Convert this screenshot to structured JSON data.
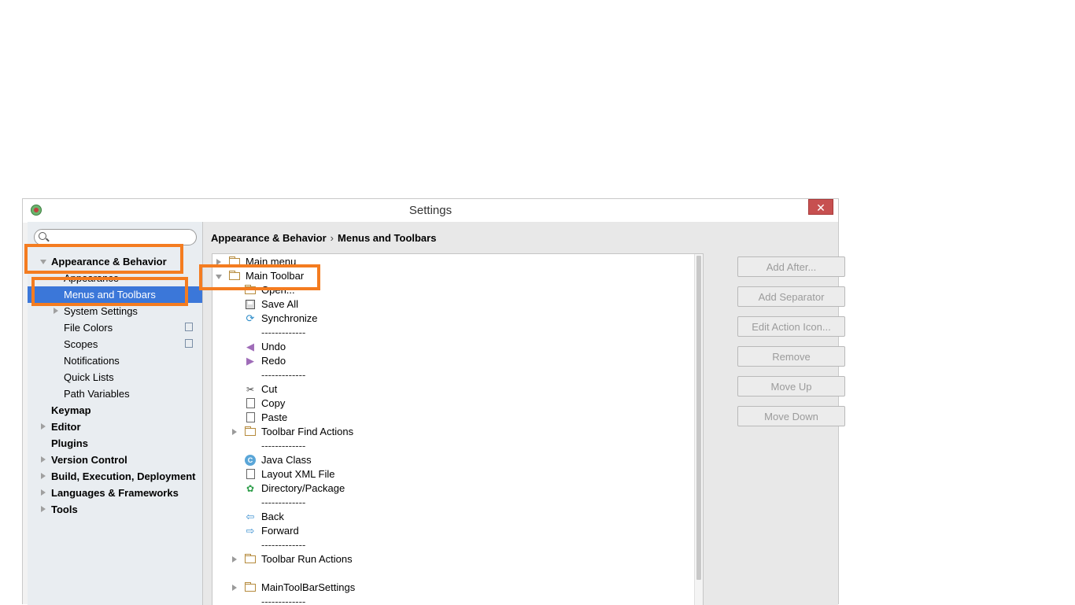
{
  "window": {
    "title": "Settings",
    "close_glyph": "✕"
  },
  "sidebar": {
    "search_placeholder": "",
    "items": [
      {
        "label": "Appearance & Behavior",
        "bold": true,
        "expanded": true
      },
      {
        "label": "Appearance"
      },
      {
        "label": "Menus and Toolbars",
        "selected": true
      },
      {
        "label": "System Settings",
        "expandable": true
      },
      {
        "label": "File Colors",
        "has_copy_icon": true
      },
      {
        "label": "Scopes",
        "has_copy_icon": true
      },
      {
        "label": "Notifications"
      },
      {
        "label": "Quick Lists"
      },
      {
        "label": "Path Variables"
      },
      {
        "label": "Keymap",
        "bold": true
      },
      {
        "label": "Editor",
        "bold": true,
        "expandable": true
      },
      {
        "label": "Plugins",
        "bold": true
      },
      {
        "label": "Version Control",
        "bold": true,
        "expandable": true
      },
      {
        "label": "Build, Execution, Deployment",
        "bold": true,
        "expandable": true
      },
      {
        "label": "Languages & Frameworks",
        "bold": true,
        "expandable": true
      },
      {
        "label": "Tools",
        "bold": true,
        "expandable": true
      }
    ]
  },
  "breadcrumb": {
    "part1": "Appearance & Behavior",
    "separator": "›",
    "part2": "Menus and Toolbars"
  },
  "tree": {
    "separator_text": "-------------",
    "nodes": [
      {
        "label": "Main menu",
        "type": "folder",
        "expandable": true
      },
      {
        "label": "Main Toolbar",
        "type": "folder",
        "expanded": true
      },
      {
        "label": "Open...",
        "type": "folder-open"
      },
      {
        "label": "Save All",
        "type": "save"
      },
      {
        "label": "Synchronize",
        "type": "sync"
      },
      {
        "label": "-------------",
        "type": "separator"
      },
      {
        "label": "Undo",
        "type": "undo"
      },
      {
        "label": "Redo",
        "type": "redo"
      },
      {
        "label": "-------------",
        "type": "separator"
      },
      {
        "label": "Cut",
        "type": "cut"
      },
      {
        "label": "Copy",
        "type": "copy"
      },
      {
        "label": "Paste",
        "type": "paste"
      },
      {
        "label": "Toolbar Find Actions",
        "type": "folder",
        "expandable": true
      },
      {
        "label": "-------------",
        "type": "separator"
      },
      {
        "label": "Java Class",
        "type": "java-class"
      },
      {
        "label": "Layout XML File",
        "type": "layout-file"
      },
      {
        "label": "Directory/Package",
        "type": "package"
      },
      {
        "label": "-------------",
        "type": "separator"
      },
      {
        "label": "Back",
        "type": "back"
      },
      {
        "label": "Forward",
        "type": "forward"
      },
      {
        "label": "-------------",
        "type": "separator"
      },
      {
        "label": "Toolbar Run Actions",
        "type": "folder",
        "expandable": true
      },
      {
        "label": "MainToolBarSettings",
        "type": "folder",
        "expandable": true
      },
      {
        "label": "-------------",
        "type": "separator"
      }
    ]
  },
  "buttons": [
    {
      "label": "Add After...",
      "enabled": false
    },
    {
      "label": "Add Separator",
      "enabled": false
    },
    {
      "label": "Edit Action Icon...",
      "enabled": false
    },
    {
      "label": "Remove",
      "enabled": false
    },
    {
      "label": "Move Up",
      "enabled": false
    },
    {
      "label": "Move Down",
      "enabled": false
    }
  ],
  "colors": {
    "highlight": "#f47c20",
    "selection": "#3b77d9"
  },
  "icons": {
    "app": "android-studio-icon",
    "search": "search-icon",
    "close": "close-icon"
  }
}
